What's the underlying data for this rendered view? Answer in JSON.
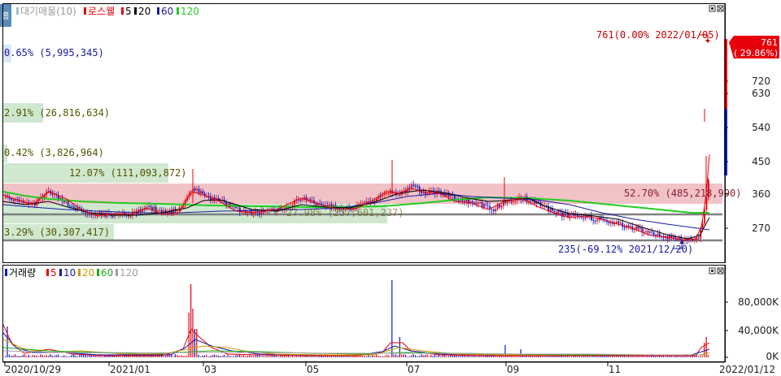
{
  "price_panel": {
    "home_icon_label": "홈",
    "legend": {
      "prefix": "대기매물(10)",
      "title": "로스웰",
      "ma": [
        "5",
        "20",
        "60",
        "120"
      ]
    },
    "volume_profile": [
      {
        "text": "0.65% (5,995,345)"
      },
      {
        "text": "2.91% (26,816,634)"
      },
      {
        "text": "0.42% (3,826,964)"
      },
      {
        "text": "12.07% (111,093,872)"
      },
      {
        "text": "52.70% (485,218,990)"
      },
      {
        "text": "27.98% (257,601,237)"
      },
      {
        "text": "3.29% (30,307,417)"
      }
    ],
    "max_annotation": "761(0.00% 2022/01/05)",
    "min_annotation": "235(-69.12% 2021/12/20)",
    "current_price": "761",
    "current_change": "( 29.86%)",
    "y_ticks": [
      "720",
      "630",
      "540",
      "450",
      "360",
      "270"
    ]
  },
  "volume_panel": {
    "legend": {
      "title": "거래량",
      "ma": [
        "5",
        "10",
        "20",
        "60",
        "120"
      ]
    },
    "y_ticks": [
      "80,000K",
      "40,000K",
      "0K"
    ]
  },
  "x_axis": {
    "labels": [
      "2020/10/29",
      "2021/01",
      "03",
      "05",
      "07",
      "09",
      "11",
      "2022/01/12"
    ]
  },
  "colors": {
    "up": "#e8000a",
    "down": "#0a1ac8",
    "ma5": "#e8000a",
    "ma20": "#000000",
    "ma60": "#1a1aa8",
    "ma120": "#22cc22",
    "profile_green": "#cfe8cf",
    "profile_red": "#f1c3c6",
    "profile_blue": "#d8e8f8",
    "price_box_bg": "#e8000a",
    "grid_line": "#808080"
  }
}
